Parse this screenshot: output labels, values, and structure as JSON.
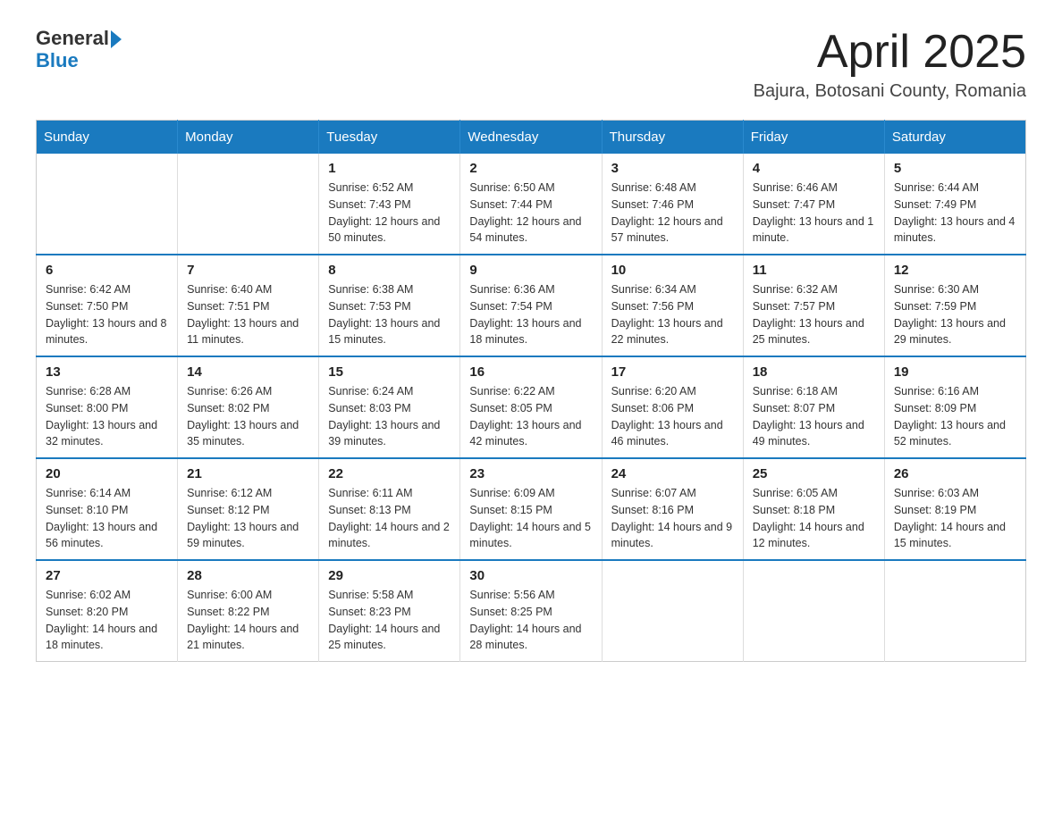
{
  "logo": {
    "text_general": "General",
    "text_blue": "Blue"
  },
  "header": {
    "title": "April 2025",
    "subtitle": "Bajura, Botosani County, Romania"
  },
  "weekdays": [
    "Sunday",
    "Monday",
    "Tuesday",
    "Wednesday",
    "Thursday",
    "Friday",
    "Saturday"
  ],
  "weeks": [
    [
      {
        "day": "",
        "sunrise": "",
        "sunset": "",
        "daylight": ""
      },
      {
        "day": "",
        "sunrise": "",
        "sunset": "",
        "daylight": ""
      },
      {
        "day": "1",
        "sunrise": "Sunrise: 6:52 AM",
        "sunset": "Sunset: 7:43 PM",
        "daylight": "Daylight: 12 hours and 50 minutes."
      },
      {
        "day": "2",
        "sunrise": "Sunrise: 6:50 AM",
        "sunset": "Sunset: 7:44 PM",
        "daylight": "Daylight: 12 hours and 54 minutes."
      },
      {
        "day": "3",
        "sunrise": "Sunrise: 6:48 AM",
        "sunset": "Sunset: 7:46 PM",
        "daylight": "Daylight: 12 hours and 57 minutes."
      },
      {
        "day": "4",
        "sunrise": "Sunrise: 6:46 AM",
        "sunset": "Sunset: 7:47 PM",
        "daylight": "Daylight: 13 hours and 1 minute."
      },
      {
        "day": "5",
        "sunrise": "Sunrise: 6:44 AM",
        "sunset": "Sunset: 7:49 PM",
        "daylight": "Daylight: 13 hours and 4 minutes."
      }
    ],
    [
      {
        "day": "6",
        "sunrise": "Sunrise: 6:42 AM",
        "sunset": "Sunset: 7:50 PM",
        "daylight": "Daylight: 13 hours and 8 minutes."
      },
      {
        "day": "7",
        "sunrise": "Sunrise: 6:40 AM",
        "sunset": "Sunset: 7:51 PM",
        "daylight": "Daylight: 13 hours and 11 minutes."
      },
      {
        "day": "8",
        "sunrise": "Sunrise: 6:38 AM",
        "sunset": "Sunset: 7:53 PM",
        "daylight": "Daylight: 13 hours and 15 minutes."
      },
      {
        "day": "9",
        "sunrise": "Sunrise: 6:36 AM",
        "sunset": "Sunset: 7:54 PM",
        "daylight": "Daylight: 13 hours and 18 minutes."
      },
      {
        "day": "10",
        "sunrise": "Sunrise: 6:34 AM",
        "sunset": "Sunset: 7:56 PM",
        "daylight": "Daylight: 13 hours and 22 minutes."
      },
      {
        "day": "11",
        "sunrise": "Sunrise: 6:32 AM",
        "sunset": "Sunset: 7:57 PM",
        "daylight": "Daylight: 13 hours and 25 minutes."
      },
      {
        "day": "12",
        "sunrise": "Sunrise: 6:30 AM",
        "sunset": "Sunset: 7:59 PM",
        "daylight": "Daylight: 13 hours and 29 minutes."
      }
    ],
    [
      {
        "day": "13",
        "sunrise": "Sunrise: 6:28 AM",
        "sunset": "Sunset: 8:00 PM",
        "daylight": "Daylight: 13 hours and 32 minutes."
      },
      {
        "day": "14",
        "sunrise": "Sunrise: 6:26 AM",
        "sunset": "Sunset: 8:02 PM",
        "daylight": "Daylight: 13 hours and 35 minutes."
      },
      {
        "day": "15",
        "sunrise": "Sunrise: 6:24 AM",
        "sunset": "Sunset: 8:03 PM",
        "daylight": "Daylight: 13 hours and 39 minutes."
      },
      {
        "day": "16",
        "sunrise": "Sunrise: 6:22 AM",
        "sunset": "Sunset: 8:05 PM",
        "daylight": "Daylight: 13 hours and 42 minutes."
      },
      {
        "day": "17",
        "sunrise": "Sunrise: 6:20 AM",
        "sunset": "Sunset: 8:06 PM",
        "daylight": "Daylight: 13 hours and 46 minutes."
      },
      {
        "day": "18",
        "sunrise": "Sunrise: 6:18 AM",
        "sunset": "Sunset: 8:07 PM",
        "daylight": "Daylight: 13 hours and 49 minutes."
      },
      {
        "day": "19",
        "sunrise": "Sunrise: 6:16 AM",
        "sunset": "Sunset: 8:09 PM",
        "daylight": "Daylight: 13 hours and 52 minutes."
      }
    ],
    [
      {
        "day": "20",
        "sunrise": "Sunrise: 6:14 AM",
        "sunset": "Sunset: 8:10 PM",
        "daylight": "Daylight: 13 hours and 56 minutes."
      },
      {
        "day": "21",
        "sunrise": "Sunrise: 6:12 AM",
        "sunset": "Sunset: 8:12 PM",
        "daylight": "Daylight: 13 hours and 59 minutes."
      },
      {
        "day": "22",
        "sunrise": "Sunrise: 6:11 AM",
        "sunset": "Sunset: 8:13 PM",
        "daylight": "Daylight: 14 hours and 2 minutes."
      },
      {
        "day": "23",
        "sunrise": "Sunrise: 6:09 AM",
        "sunset": "Sunset: 8:15 PM",
        "daylight": "Daylight: 14 hours and 5 minutes."
      },
      {
        "day": "24",
        "sunrise": "Sunrise: 6:07 AM",
        "sunset": "Sunset: 8:16 PM",
        "daylight": "Daylight: 14 hours and 9 minutes."
      },
      {
        "day": "25",
        "sunrise": "Sunrise: 6:05 AM",
        "sunset": "Sunset: 8:18 PM",
        "daylight": "Daylight: 14 hours and 12 minutes."
      },
      {
        "day": "26",
        "sunrise": "Sunrise: 6:03 AM",
        "sunset": "Sunset: 8:19 PM",
        "daylight": "Daylight: 14 hours and 15 minutes."
      }
    ],
    [
      {
        "day": "27",
        "sunrise": "Sunrise: 6:02 AM",
        "sunset": "Sunset: 8:20 PM",
        "daylight": "Daylight: 14 hours and 18 minutes."
      },
      {
        "day": "28",
        "sunrise": "Sunrise: 6:00 AM",
        "sunset": "Sunset: 8:22 PM",
        "daylight": "Daylight: 14 hours and 21 minutes."
      },
      {
        "day": "29",
        "sunrise": "Sunrise: 5:58 AM",
        "sunset": "Sunset: 8:23 PM",
        "daylight": "Daylight: 14 hours and 25 minutes."
      },
      {
        "day": "30",
        "sunrise": "Sunrise: 5:56 AM",
        "sunset": "Sunset: 8:25 PM",
        "daylight": "Daylight: 14 hours and 28 minutes."
      },
      {
        "day": "",
        "sunrise": "",
        "sunset": "",
        "daylight": ""
      },
      {
        "day": "",
        "sunrise": "",
        "sunset": "",
        "daylight": ""
      },
      {
        "day": "",
        "sunrise": "",
        "sunset": "",
        "daylight": ""
      }
    ]
  ]
}
